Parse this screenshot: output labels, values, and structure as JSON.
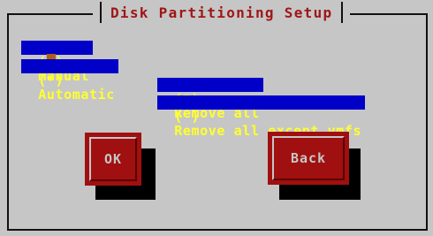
{
  "dialog": {
    "title": "Disk Partitioning Setup"
  },
  "options": {
    "manual": {
      "marker": "( )",
      "label": "Manual"
    },
    "automatic": {
      "marker": "(*)",
      "label": "Automatic"
    },
    "remove_all": {
      "marker": "(*)",
      "label": "Remove all"
    },
    "remove_except_vmfs": {
      "marker": "( )",
      "label": "Remove all except vmfs"
    }
  },
  "buttons": {
    "ok": "OK",
    "back": "Back"
  },
  "colors": {
    "background": "#c6c6c6",
    "option_bg": "#0000c8",
    "option_text": "#ffff30",
    "title_text": "#a01616",
    "button_bg": "#a01010",
    "cursor": "#b06010"
  }
}
